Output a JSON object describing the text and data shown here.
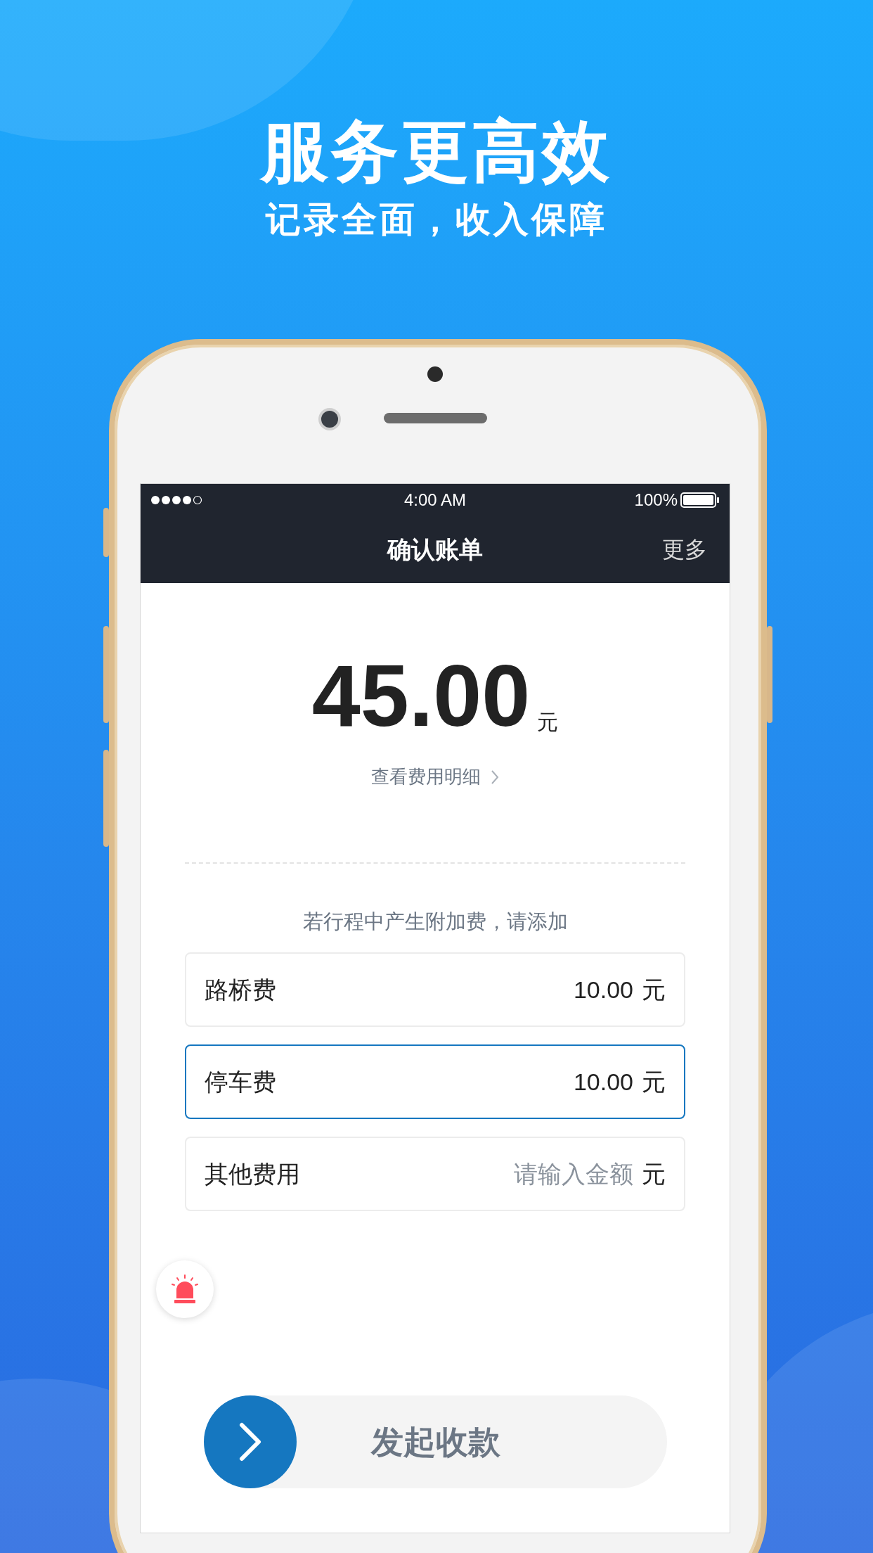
{
  "headline": "服务更高效",
  "subtitle": "记录全面，收入保障",
  "status_bar": {
    "time": "4:00 AM",
    "battery": "100%"
  },
  "nav": {
    "title": "确认账单",
    "more": "更多"
  },
  "amount": {
    "value": "45.00",
    "unit": "元"
  },
  "detail_link": "查看费用明细",
  "hint": "若行程中产生附加费，请添加",
  "fees": [
    {
      "label": "路桥费",
      "value": "10.00",
      "unit": "元",
      "focused": false
    },
    {
      "label": "停车费",
      "value": "10.00",
      "unit": "元",
      "focused": true
    },
    {
      "label": "其他费用",
      "placeholder": "请输入金额",
      "unit": "元",
      "focused": false
    }
  ],
  "slider_button": {
    "label": "发起收款",
    "level": 0
  }
}
